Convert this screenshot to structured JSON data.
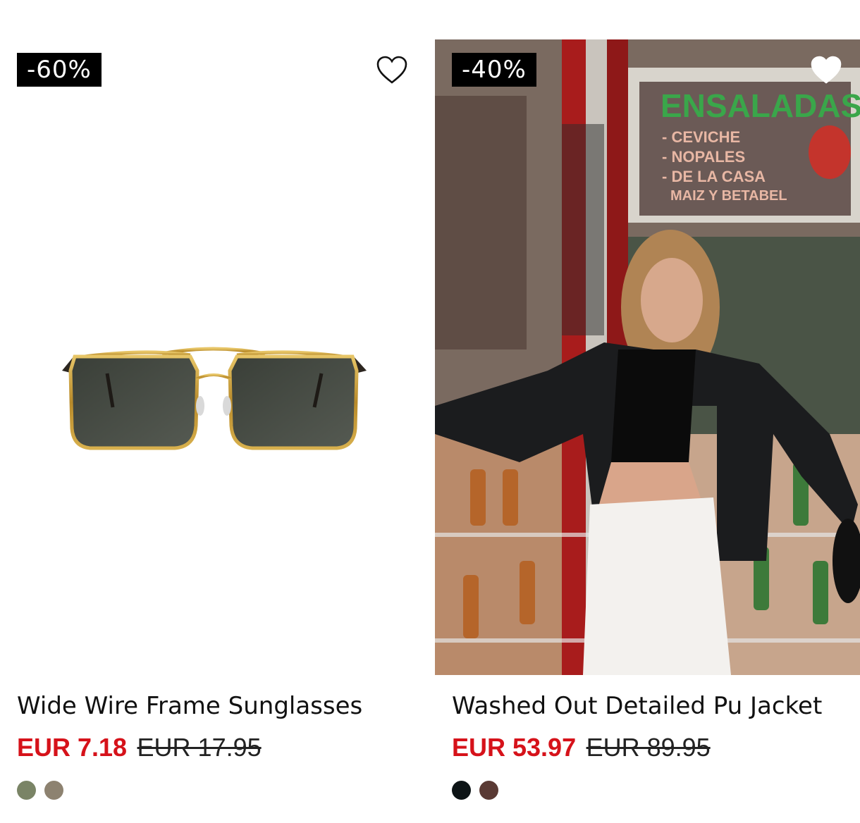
{
  "products": [
    {
      "discount": "-60%",
      "title": "Wide Wire Frame Sunglasses",
      "price_sale": "EUR 7.18",
      "price_original": "EUR 17.95",
      "wishlist_icon": "heart-outline-icon",
      "swatches": [
        "#7a8466",
        "#8d8270"
      ]
    },
    {
      "discount": "-40%",
      "title": "Washed Out Detailed Pu Jacket",
      "price_sale": "EUR 53.97",
      "price_original": "EUR 89.95",
      "wishlist_icon": "heart-filled-icon",
      "swatches": [
        "#0d1416",
        "#5a3a34"
      ]
    }
  ],
  "colors": {
    "sale_red": "#d6121a",
    "badge_bg": "#000000"
  }
}
